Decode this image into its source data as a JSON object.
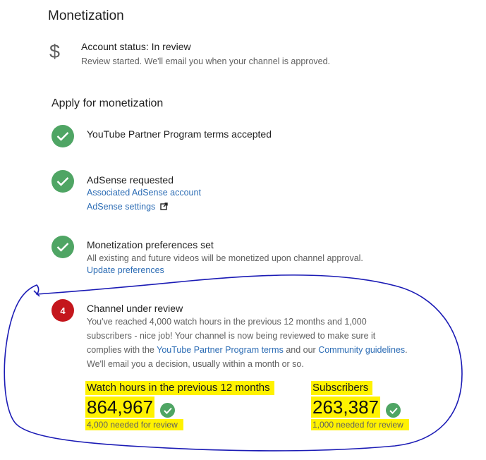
{
  "header": {
    "title": "Monetization"
  },
  "account": {
    "icon": "dollar-icon",
    "status": "Account status: In review",
    "subtext": "Review started. We'll email you when your channel is approved."
  },
  "apply": {
    "title": "Apply for monetization",
    "steps": [
      {
        "title": "YouTube Partner Program terms accepted",
        "icon": "check-icon"
      },
      {
        "title": "AdSense requested",
        "link1": "Associated AdSense account",
        "link2": "AdSense settings",
        "icon": "check-icon"
      },
      {
        "title": "Monetization preferences set",
        "desc": "All existing and future videos will be monetized upon channel approval.",
        "link": "Update preferences",
        "icon": "check-icon"
      },
      {
        "number": "4",
        "title": "Channel under review",
        "desc1": "You've reached 4,000 watch hours in the previous 12 months and 1,000",
        "desc2": "subscribers - nice job! Your channel is now being reviewed to make sure it",
        "desc3_pre": "complies with the ",
        "desc3_link1": "YouTube Partner Program terms",
        "desc3_mid": " and our ",
        "desc3_link2": "Community guidelines",
        "desc3_post": ".",
        "desc4": "We'll email you a decision, usually within a month or so."
      }
    ]
  },
  "stats": {
    "watch": {
      "label": "Watch hours in the previous 12 months",
      "value": "864,967",
      "needed": "4,000 needed for review"
    },
    "subs": {
      "label": "Subscribers",
      "value": "263,387",
      "needed": "1,000 needed for review"
    }
  },
  "colors": {
    "accent": "#2d6db5",
    "success": "#4fa564",
    "error": "#c4161c",
    "highlight": "#fff200",
    "annotation": "#1b1bb5"
  }
}
